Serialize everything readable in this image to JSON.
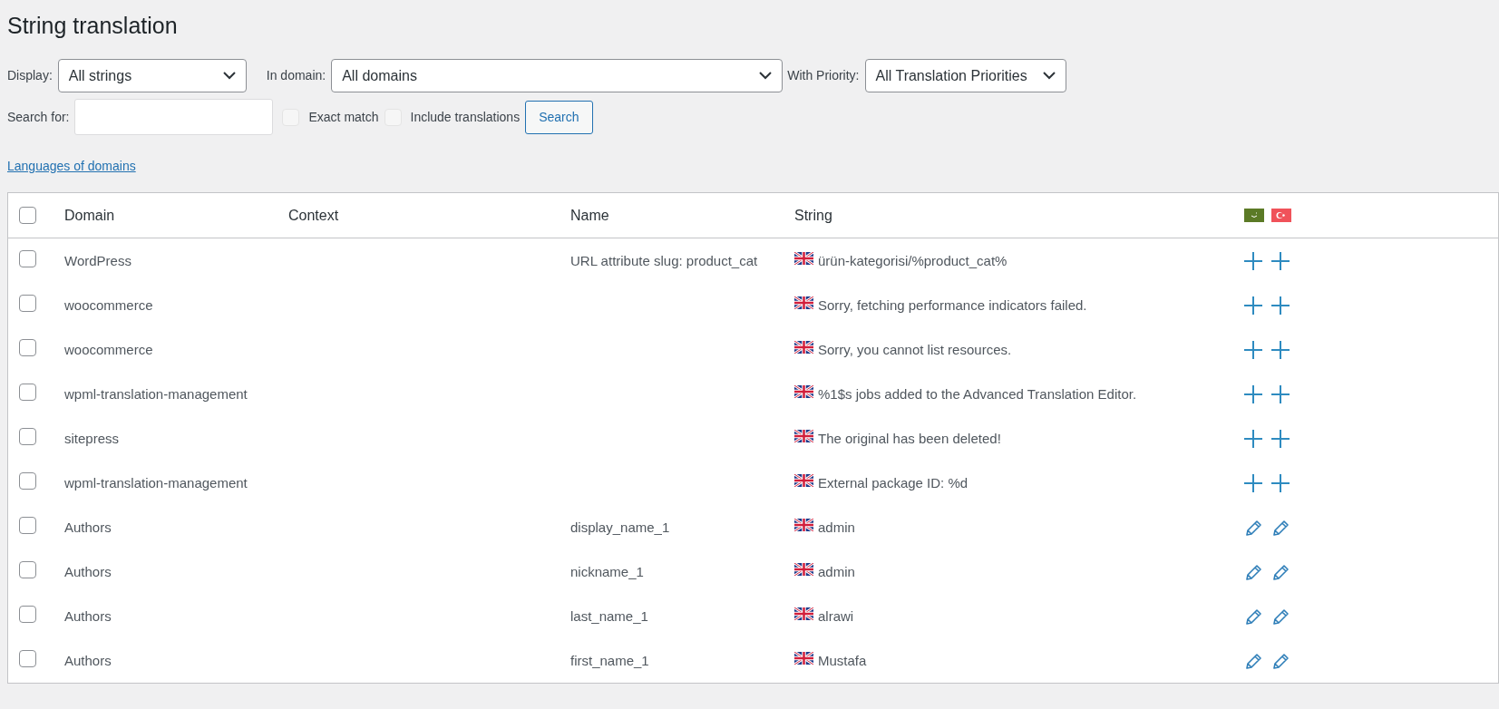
{
  "title": "String translation",
  "filters": {
    "display": {
      "label": "Display:",
      "value": "All strings"
    },
    "domain": {
      "label": "In domain:",
      "value": "All domains"
    },
    "priority": {
      "label": "With Priority:",
      "value": "All Translation Priorities"
    },
    "search": {
      "label": "Search for:",
      "exact_match": {
        "label": "Exact match",
        "checked": false
      },
      "include_translations": {
        "label": "Include translations",
        "checked": false
      },
      "button": "Search"
    }
  },
  "languages_link": "Languages of domains",
  "table": {
    "select_all": {
      "checked": false
    },
    "columns": [
      "Domain",
      "Context",
      "Name",
      "String"
    ],
    "languages": [
      {
        "kind": "arabic"
      },
      {
        "kind": "turkish"
      }
    ],
    "rows": [
      {
        "checked": false,
        "domain": "WordPress",
        "name": "URL attribute slug: product_cat",
        "string": "ürün-kategorisi/%product_cat%",
        "translations": [
          {
            "kind": "add"
          },
          {
            "kind": "add"
          }
        ]
      },
      {
        "checked": false,
        "domain": "woocommerce",
        "string": "Sorry, fetching performance indicators failed.",
        "translations": [
          {
            "kind": "add"
          },
          {
            "kind": "add"
          }
        ]
      },
      {
        "checked": false,
        "domain": "woocommerce",
        "string": "Sorry, you cannot list resources.",
        "translations": [
          {
            "kind": "add"
          },
          {
            "kind": "add"
          }
        ]
      },
      {
        "checked": false,
        "domain": "wpml-translation-management",
        "string": "%1$s jobs added to the Advanced Translation Editor.",
        "translations": [
          {
            "kind": "add"
          },
          {
            "kind": "add"
          }
        ]
      },
      {
        "checked": false,
        "domain": "sitepress",
        "string": "The original has been deleted!",
        "translations": [
          {
            "kind": "add"
          },
          {
            "kind": "add"
          }
        ]
      },
      {
        "checked": false,
        "domain": "wpml-translation-management",
        "string": "External package ID: %d",
        "translations": [
          {
            "kind": "add"
          },
          {
            "kind": "add"
          }
        ]
      },
      {
        "checked": false,
        "domain": "Authors",
        "name": "display_name_1",
        "string": "admin",
        "translations": [
          {
            "kind": "edit"
          },
          {
            "kind": "edit"
          }
        ]
      },
      {
        "checked": false,
        "domain": "Authors",
        "name": "nickname_1",
        "string": "admin",
        "translations": [
          {
            "kind": "edit"
          },
          {
            "kind": "edit"
          }
        ]
      },
      {
        "checked": false,
        "domain": "Authors",
        "name": "last_name_1",
        "string": "alrawi",
        "translations": [
          {
            "kind": "edit"
          },
          {
            "kind": "edit"
          }
        ]
      },
      {
        "checked": false,
        "domain": "Authors",
        "name": "first_name_1",
        "string": "Mustafa",
        "translations": [
          {
            "kind": "edit"
          },
          {
            "kind": "edit"
          }
        ]
      }
    ]
  }
}
